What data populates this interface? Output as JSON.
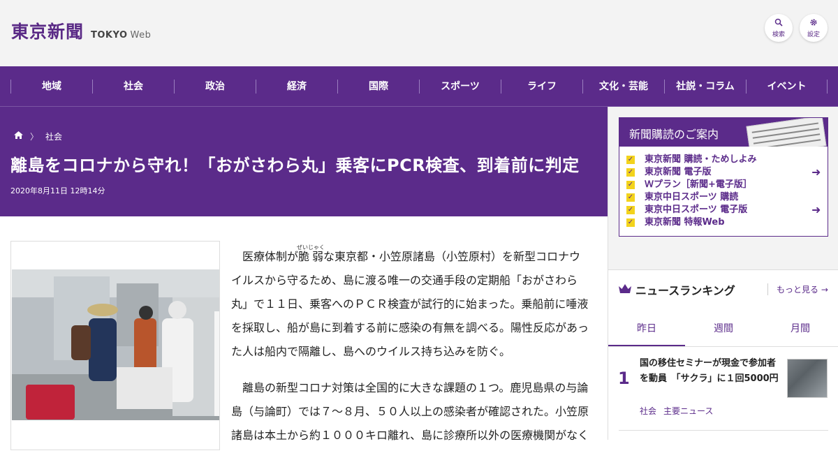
{
  "header": {
    "logo_jp": "東京新聞",
    "logo_en": "TOKYO",
    "logo_web": "Web",
    "search_label": "検索",
    "settings_label": "設定"
  },
  "nav": [
    "地域",
    "社会",
    "政治",
    "経済",
    "国際",
    "スポーツ",
    "ライフ",
    "文化・芸能",
    "社説・コラム",
    "イベント"
  ],
  "article": {
    "breadcrumb": "社会",
    "title": "離島をコロナから守れ！「おがさわら丸」乗客にPCR検査、到着前に判定",
    "date": "2020年8月11日 12時14分",
    "p1_before": "医療体制が",
    "p1_ruby": "脆弱",
    "p1_ruby_reading": "ぜいじゃく",
    "p1_after": "な東京都・小笠原諸島（小笠原村）を新型コロナウイルスから守るため、島に渡る唯一の交通手段の定期船「おがさわら丸」で１１日、乗客へのＰＣＲ検査が試行的に始まった。乗船前に唾液を採取し、船が島に到着する前に感染の有無を調べる。陽性反応があった人は船内で隔離し、島へのウイルス持ち込みを防ぐ。",
    "p2": "離島の新型コロナ対策は全国的に大きな課題の１つ。鹿児島県の与論島（与論町）では７～８月、５０人以上の感染者が確認された。小笠原諸島は本土から約１０００キロ離れ、島に診療所以外の医療機関がなく"
  },
  "sidebar": {
    "subscribe_title": "新聞購読のご案内",
    "subscribe_items": [
      {
        "label": "東京新聞 購読・ためしよみ",
        "arrow": false
      },
      {
        "label": "東京新聞 電子版",
        "arrow": true
      },
      {
        "label": "Ｗプラン［新聞+電子版］",
        "arrow": false
      },
      {
        "label": "東京中日スポーツ 購読",
        "arrow": false
      },
      {
        "label": "東京中日スポーツ 電子版",
        "arrow": true
      },
      {
        "label": "東京新聞 特報Web",
        "arrow": false
      }
    ],
    "ranking_title": "ニュースランキング",
    "ranking_more": "もっと見る",
    "tabs": [
      "昨日",
      "週間",
      "月間"
    ],
    "rank_item": {
      "num": "1",
      "title": "国の移住セミナーが現金で参加者を動員　「サクラ」に１回5000円",
      "tags": [
        "社会",
        "主要ニュース"
      ]
    }
  },
  "colors": {
    "brand": "#5b2b8a",
    "accent": "#f3d31c"
  }
}
